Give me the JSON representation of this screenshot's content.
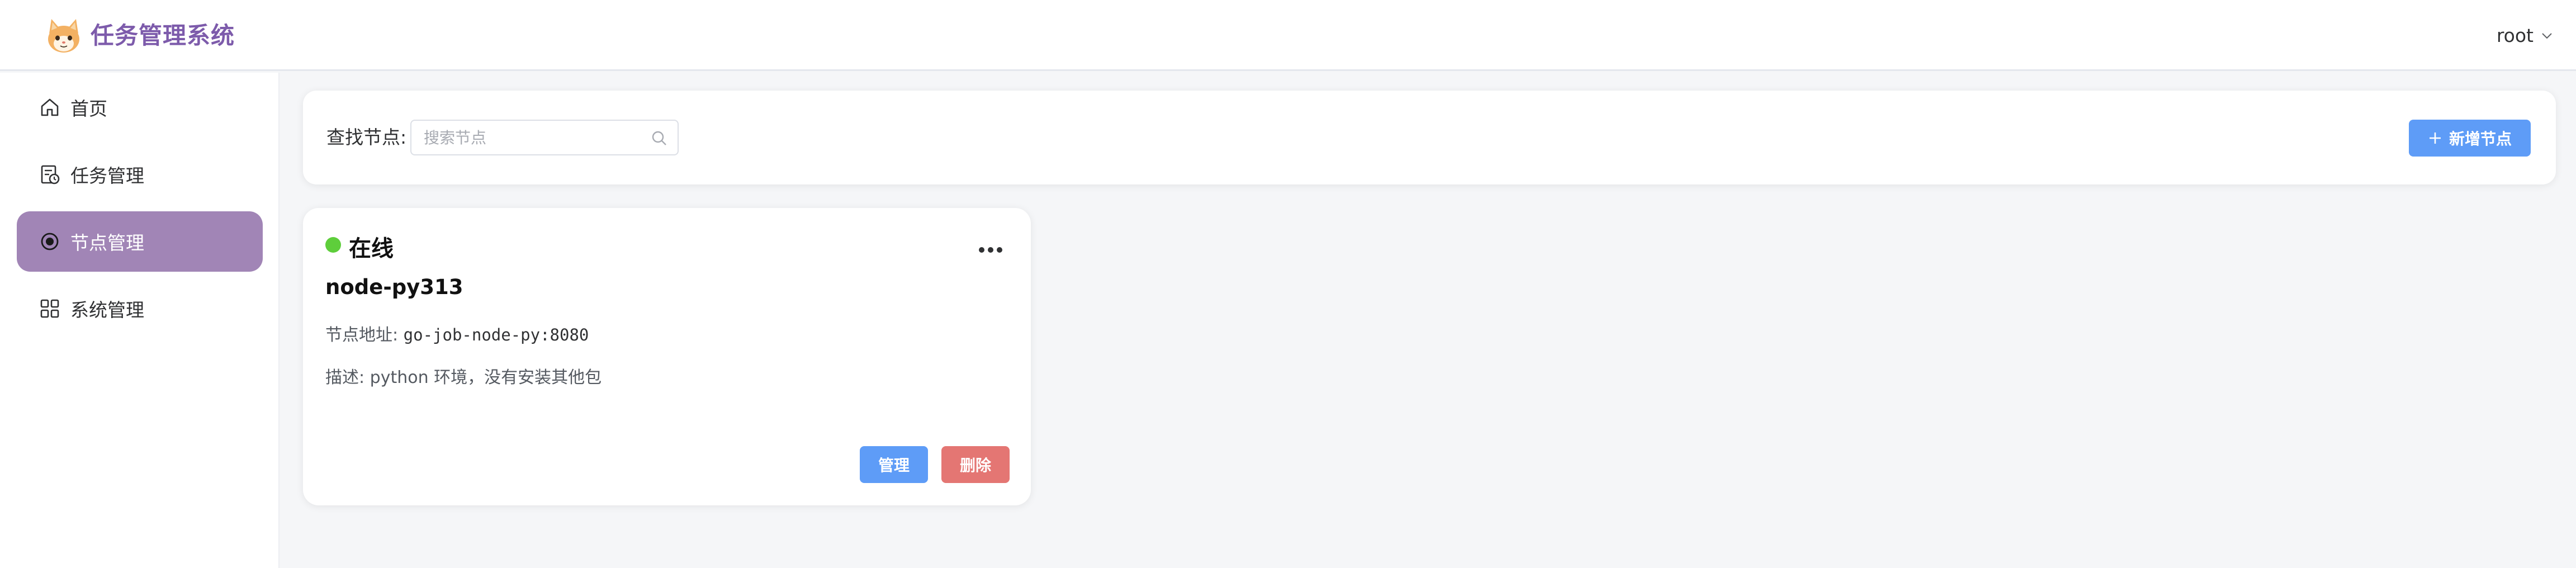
{
  "app": {
    "title": "任务管理系统"
  },
  "user": {
    "name": "root"
  },
  "sidebar": {
    "items": [
      {
        "label": "首页",
        "icon": "home-icon",
        "active": false
      },
      {
        "label": "任务管理",
        "icon": "task-calendar-icon",
        "active": false
      },
      {
        "label": "节点管理",
        "icon": "node-radio-icon",
        "active": true
      },
      {
        "label": "系统管理",
        "icon": "grid-apps-icon",
        "active": false
      }
    ]
  },
  "search": {
    "label": "查找节点:",
    "placeholder": "搜索节点",
    "value": ""
  },
  "toolbar": {
    "add_label": "新增节点"
  },
  "nodes": [
    {
      "status": "在线",
      "name": "node-py313",
      "address_label": "节点地址:",
      "address": "go-job-node-py:8080",
      "desc_label": "描述:",
      "desc": "python 环境，没有安装其他包",
      "manage_label": "管理",
      "delete_label": "删除"
    }
  ],
  "colors": {
    "brand": "#7d5bab",
    "active_menu": "#a185b6",
    "primary": "#5e9cf7",
    "danger": "#e47673",
    "online": "#5ece3b"
  }
}
